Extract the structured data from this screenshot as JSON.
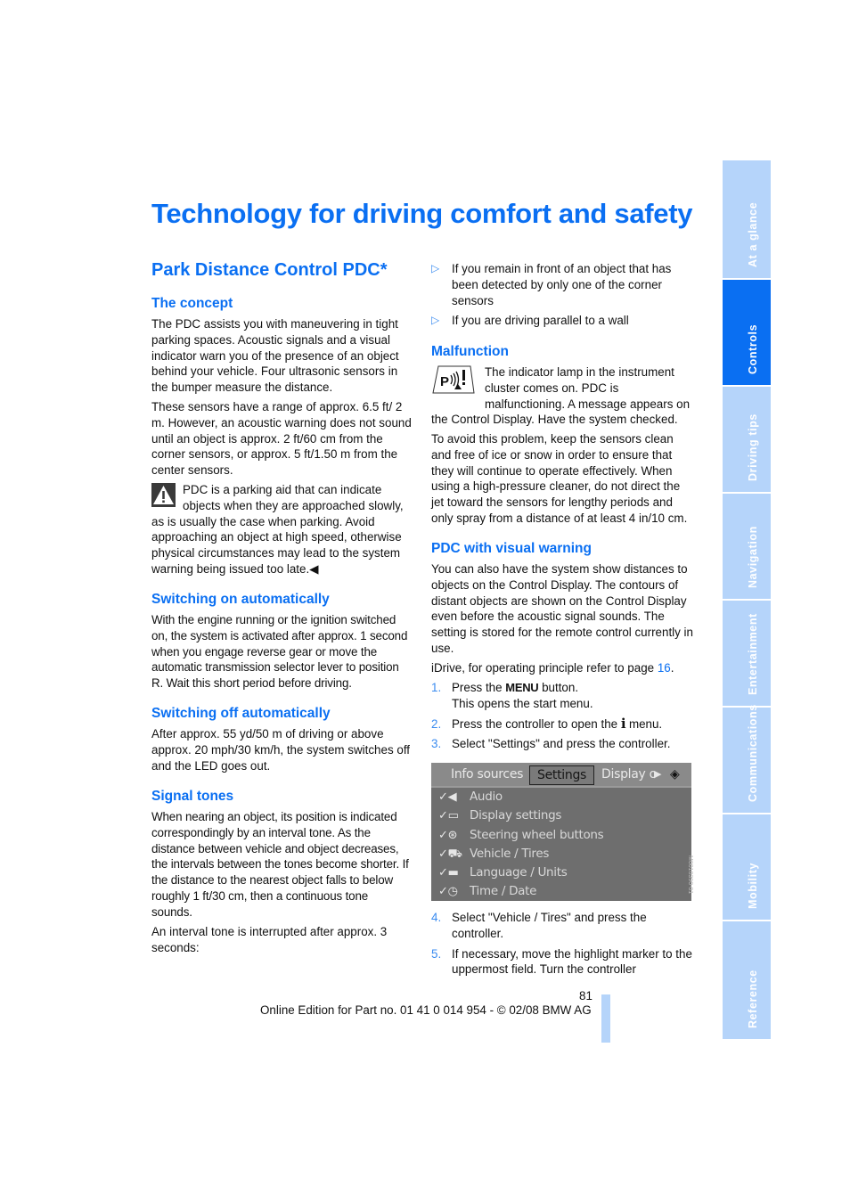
{
  "page_title": "Technology for driving comfort and safety",
  "section_title": "Park Distance Control PDC*",
  "left_column": {
    "concept": {
      "heading": "The concept",
      "p1": "The PDC assists you with maneuvering in tight parking spaces. Acoustic signals and a visual indicator warn you of the presence of an object behind your vehicle. Four ultrasonic sensors in the bumper measure the distance.",
      "p2": "These sensors have a range of approx. 6.5 ft/ 2 m. However, an acoustic warning does not sound until an object is approx. 2 ft/60 cm from the corner sensors, or approx. 5 ft/1.50 m from the center sensors.",
      "warning": "PDC is a parking aid that can indicate objects when they are approached slowly, as is usually the case when parking. Avoid approaching an object at high speed, otherwise physical circumstances may lead to the system warning being issued too late.",
      "end_mark": "◀"
    },
    "switch_on": {
      "heading": "Switching on automatically",
      "text": "With the engine running or the ignition switched on, the system is activated after approx. 1 second when you engage reverse gear or move the automatic transmission selector lever to position R. Wait this short period before driving."
    },
    "switch_off": {
      "heading": "Switching off automatically",
      "text": "After approx. 55 yd/50 m of driving or above approx. 20 mph/30 km/h, the system switches off and the LED goes out."
    },
    "signal_tones": {
      "heading": "Signal tones",
      "p1": "When nearing an object, its position is indicated correspondingly by an interval tone. As the distance between vehicle and object decreases, the intervals between the tones become shorter. If the distance to the nearest object falls to below roughly 1 ft/30 cm, then a continuous tone sounds.",
      "p2": "An interval tone is interrupted after approx. 3 seconds:"
    }
  },
  "right_column": {
    "bullets": [
      "If you remain in front of an object that has been detected by only one of the corner sensors",
      "If you are driving parallel to a wall"
    ],
    "bullet_mark": "▷",
    "malfunction": {
      "heading": "Malfunction",
      "icon_text": "P",
      "p1": "The indicator lamp in the instrument cluster comes on. PDC is malfunctioning. A message appears on the Control Display. Have the system checked.",
      "p2": "To avoid this problem, keep the sensors clean and free of ice or snow in order to ensure that they will continue to operate effectively. When using a high-pressure cleaner, do not direct the jet toward the sensors for lengthy periods and only spray from a distance of at least 4 in/10 cm."
    },
    "visual_warning": {
      "heading": "PDC with visual warning",
      "p1": "You can also have the system show distances to objects on the Control Display. The contours of distant objects are shown on the Control Display even before the acoustic signal sounds. The setting is stored for the remote control currently in use.",
      "idrive_text": "iDrive, for operating principle refer to page ",
      "idrive_page": "16",
      "idrive_end": "."
    },
    "steps": [
      {
        "num": "1.",
        "pre": "Press the ",
        "kbd": "MENU",
        "post": " button.",
        "sub": "This opens the start menu."
      },
      {
        "num": "2.",
        "pre": "Press the controller to open the ",
        "kbd": "i",
        "post": " menu.",
        "sub": ""
      },
      {
        "num": "3.",
        "pre": "Select \"Settings\" and press the controller.",
        "kbd": "",
        "post": "",
        "sub": ""
      }
    ],
    "steps_after": [
      {
        "num": "4.",
        "text": "Select \"Vehicle / Tires\" and press the controller."
      },
      {
        "num": "5.",
        "text": "If necessary, move the highlight marker to the uppermost field. Turn the controller"
      }
    ]
  },
  "screen": {
    "tabs": [
      "Info sources",
      "Settings",
      "Display o"
    ],
    "selected_tab": "Settings",
    "items": [
      {
        "icon": "audio-icon",
        "glyph": "✓◀",
        "label": "Audio"
      },
      {
        "icon": "display-icon",
        "glyph": "✓▭",
        "label": "Display settings"
      },
      {
        "icon": "steering-wheel-icon",
        "glyph": "✓⊛",
        "label": "Steering wheel buttons"
      },
      {
        "icon": "vehicle-icon",
        "glyph": "✓⛟",
        "label": "Vehicle / Tires"
      },
      {
        "icon": "language-icon",
        "glyph": "✓▬",
        "label": "Language / Units"
      },
      {
        "icon": "clock-icon",
        "glyph": "✓◷",
        "label": "Time / Date"
      }
    ],
    "code": "M0010390-01"
  },
  "sidebar": {
    "tabs": [
      {
        "label": "At a glance",
        "active": false
      },
      {
        "label": "Controls",
        "active": true
      },
      {
        "label": "Driving tips",
        "active": false
      },
      {
        "label": "Navigation",
        "active": false
      },
      {
        "label": "Entertainment",
        "active": false
      },
      {
        "label": "Communications",
        "active": false
      },
      {
        "label": "Mobility",
        "active": false
      },
      {
        "label": "Reference",
        "active": false
      }
    ]
  },
  "footer": {
    "page_number": "81",
    "text": "Online Edition for Part no. 01 41 0 014 954  - © 02/08 BMW AG"
  }
}
